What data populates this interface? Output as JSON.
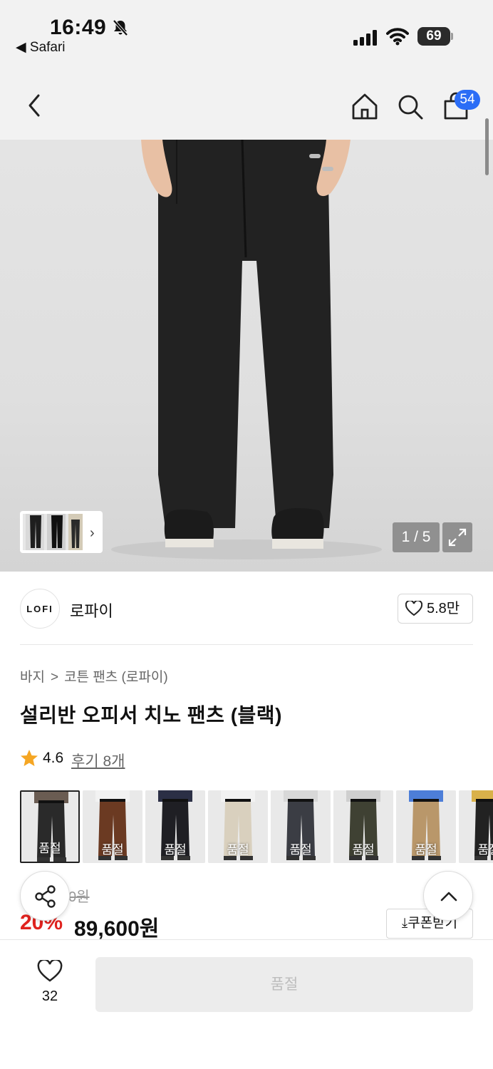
{
  "status_bar": {
    "time": "16:49",
    "back_app": "◀ Safari",
    "battery": "69"
  },
  "nav": {
    "cart_count": "54"
  },
  "gallery": {
    "counter": "1 / 5"
  },
  "brand": {
    "logo_text": "LOFI",
    "name": "로파이",
    "favorite_count": "5.8만"
  },
  "breadcrumb": {
    "category": "바지",
    "separator": ">",
    "subcategory": "코튼 팬츠 (로파이)"
  },
  "product": {
    "title": "설리반 오피서 치노 팬츠 (블랙)",
    "rating": "4.6",
    "review_label": "후기 8개"
  },
  "options": [
    {
      "label": "품절",
      "color": "#2a2a2a",
      "top": "#6a5c52"
    },
    {
      "label": "품절",
      "color": "#6b3a22",
      "top": "#f2f2f2"
    },
    {
      "label": "품절",
      "color": "#1f1f24",
      "top": "#2b2f45"
    },
    {
      "label": "품절",
      "color": "#d9d0be",
      "top": "#f2f2f2"
    },
    {
      "label": "품절",
      "color": "#3b3d44",
      "top": "#d8d8d8"
    },
    {
      "label": "품절",
      "color": "#3f4133",
      "top": "#cfcfcf"
    },
    {
      "label": "품절",
      "color": "#b9976a",
      "top": "#4d7ed8"
    },
    {
      "label": "품절",
      "color": "#222222",
      "top": "#d9b14a"
    }
  ],
  "price": {
    "original": "0원",
    "discount": "20%",
    "sale": "89,600원",
    "coupon_label": "⤓쿠폰받기"
  },
  "bottom": {
    "like_count": "32",
    "soldout_label": "품절"
  }
}
